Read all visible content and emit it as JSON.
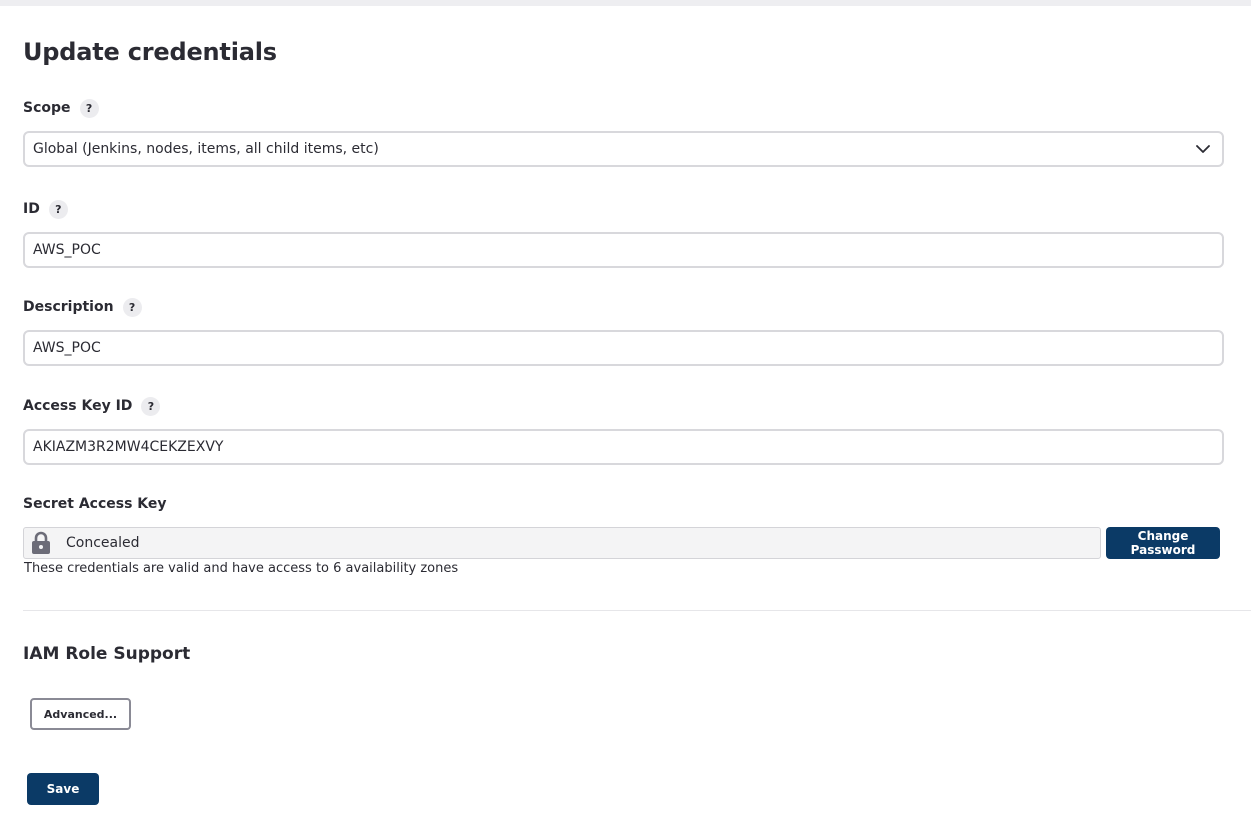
{
  "page": {
    "title": "Update credentials"
  },
  "help_glyph": "?",
  "fields": {
    "scope": {
      "label": "Scope",
      "selected": "Global (Jenkins, nodes, items, all child items, etc)"
    },
    "id": {
      "label": "ID",
      "value": "AWS_POC"
    },
    "description": {
      "label": "Description",
      "value": "AWS_POC"
    },
    "access_key_id": {
      "label": "Access Key ID",
      "value": "AKIAZM3R2MW4CEKZEXVY"
    },
    "secret_access_key": {
      "label": "Secret Access Key",
      "concealed_text": "Concealed",
      "change_button": "Change Password",
      "validation_message": "These credentials are valid and have access to 6 availability zones"
    }
  },
  "iam": {
    "title": "IAM Role Support",
    "advanced_button": "Advanced..."
  },
  "actions": {
    "save": "Save"
  },
  "colors": {
    "primary": "#0b3a66",
    "border": "#d8d8dc",
    "concealed_bg": "#f4f4f5"
  },
  "icons": [
    "help-icon",
    "chevron-down-icon",
    "lock-icon"
  ]
}
